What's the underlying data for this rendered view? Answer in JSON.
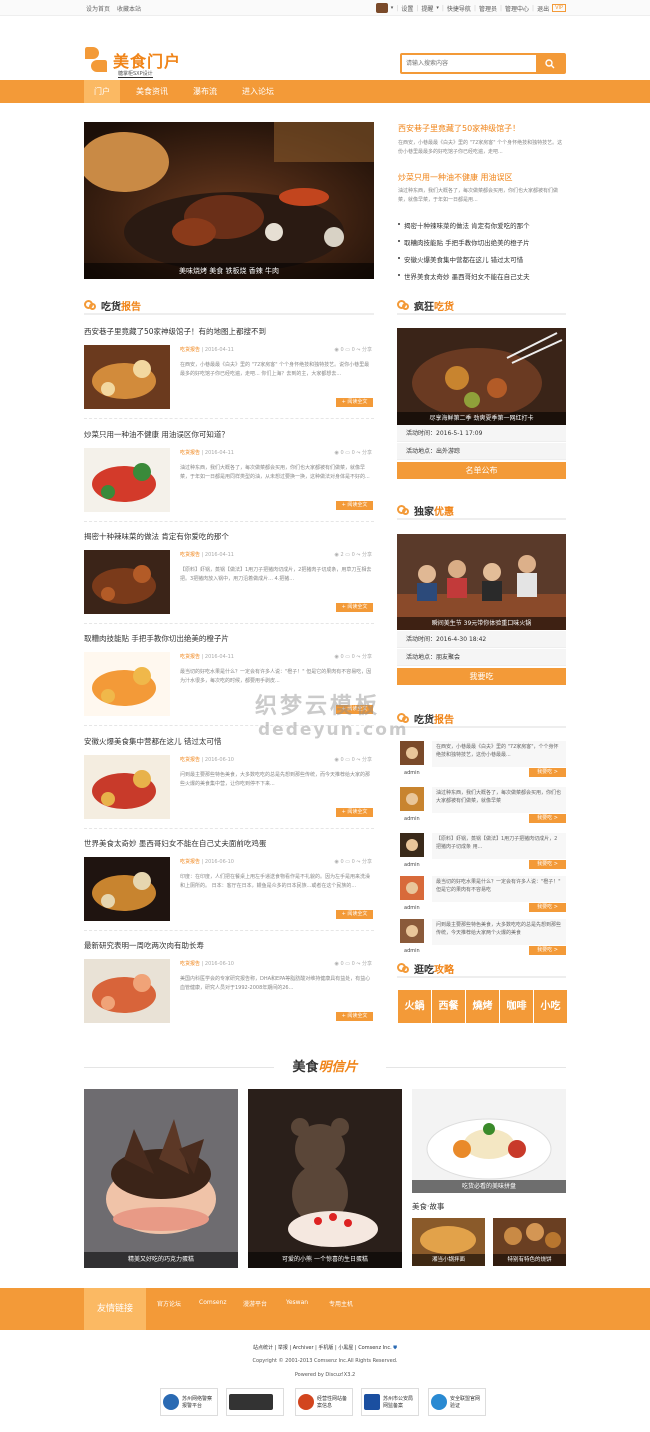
{
  "topbar": {
    "set_home": "设为首页",
    "bookmark": "收藏本站",
    "right_links": [
      "设置",
      "提醒",
      "快捷导航",
      "管理员",
      "管理中心",
      "退出"
    ],
    "vip_badge": "VIP"
  },
  "header": {
    "logo_text": "美食门户",
    "logo_sub": "糖掌柜SXP设计",
    "search_placeholder": "请输入搜索内容"
  },
  "nav": {
    "items": [
      "门户",
      "美食资讯",
      "瀑布流",
      "进入论坛"
    ],
    "active_index": 0
  },
  "hero": {
    "caption": "美味烧烤 美食 铁板烧 香辣 牛肉"
  },
  "top_news": {
    "headline1": "西安巷子里竟藏了50家神级馆子！",
    "summary1": "在西安，小巷最最《白夫》里的 \"72家房客\" 个个身怀绝技和独特技艺。这份小巷里最最多的好吃馆子你已经吃遍，走吧...",
    "headline2": "炒菜只用一种油不健康 用油误区",
    "summary2": "油过种东西，我们大概各了，每次做菜都会买用，你们也大家都被有们做菜，就像早菜，于年如一日都是用...",
    "bullets": [
      "揭密十种辣味菜的做法 肯定有你爱吃的那个",
      "取糟肉技能贴 手把手教你切出绝美的橙子片",
      "安徽火爆美食集中营都在这儿 错过太可惜",
      "世界美食太奇妙 墨西哥妇女不能在自己丈夫"
    ]
  },
  "report": {
    "title_a": "吃货",
    "title_b": "报告",
    "more_label": "+ 阅读全文",
    "articles": [
      {
        "title": "西安巷子里竟藏了50家神级馆子！有的地图上都搜不到",
        "cat": "吃货报告",
        "date": "2016-04-11",
        "views": "0",
        "comments": "0",
        "share": "分享",
        "desc": "在西安，小巷最最《白夫》里的 \"72家房客\" 个个身怀绝技和独特技艺。说你小巷里最最多的好吃馆子你已经吃遍，走吧... 你们上海？去到的主，大家都想去..."
      },
      {
        "title": "炒菜只用一种油不健康 用油误区你可知道？",
        "cat": "吃货报告",
        "date": "2016-04-11",
        "views": "0",
        "comments": "0",
        "share": "分享",
        "desc": "油过种东西，我们大概各了，每次做菜都会买用，你们也大家都被有们做菜，就像早菜，于年如一日都是用同样类型的油，从未想过要换一换，这种做法对身体是不好的..."
      },
      {
        "title": "揭密十种辣味菜的做法 肯定有你爱吃的那个",
        "cat": "吃货报告",
        "date": "2016-04-11",
        "views": "2",
        "comments": "0",
        "share": "分享",
        "desc": "【原料】虾锅，蒸锅【做法】1用刀子把猪肉切成片，2把猪肉子切成条，用草刀互相去把。3把猪肉放入锅中，用刀沿着做成片... 4.把猪..."
      },
      {
        "title": "取糟肉技能贴 手把手教你切出绝美的橙子片",
        "cat": "吃货报告",
        "date": "2016-04-11",
        "views": "0",
        "comments": "0",
        "share": "分享",
        "desc": "最当切的好吃水果是什么？一定会有许多人说：\"橙子！\" 但是它的果肉有不容易吃，因为汁水很多，每次吃的时候，都要用手剥皮..."
      },
      {
        "title": "安徽火爆美食集中营都在这儿 错过太可惜",
        "cat": "吃货报告",
        "date": "2016-06-10",
        "views": "0",
        "comments": "0",
        "share": "分享",
        "desc": "问到最主要那些特色美食，大多数吃吃的总是先想到那些传统，而今天推荐给大家的那些火爆的美食集中营，让你吃到停不下来..."
      },
      {
        "title": "世界美食太奇妙 墨西哥妇女不能在自己丈夫面前吃鸡蛋",
        "cat": "吃货报告",
        "date": "2016-06-10",
        "views": "0",
        "comments": "0",
        "share": "分享",
        "desc": "印度：在印度，人们把在餐桌上用左手递送食物看作是不礼貌的。因为左手是用来洗澡和上厕所的。 日本：客厅在日本，鳗鱼是众多的日本民族...或者在这个民族的..."
      },
      {
        "title": "最新研究表明一周吃两次肉有助长寿",
        "cat": "吃货报告",
        "date": "2016-06-10",
        "views": "0",
        "comments": "0",
        "share": "分享",
        "desc": "美国内科医学会的专家研究报告称，DHA和EPA等脂肪酸对维持健康具有益处，有益心血管健康，研究人员对于1992-2008年期间的26..."
      }
    ]
  },
  "crazy": {
    "title_a": "疯狂",
    "title_b": "吃货",
    "caption": "尽享海鲜第二季 劲爽夏季第一网红打卡",
    "rows": [
      "活动时间：2016-5-1 17:09",
      "活动地点：出外游踪"
    ],
    "button": "名单公布"
  },
  "exclusive": {
    "title_a": "独家",
    "title_b": "优惠",
    "caption": "瞬间美生节 39元带你体验重口味火锅",
    "rows": [
      "活动时间：2016-4-30 18:42",
      "活动地点：朋友聚会"
    ],
    "button": "我要吃"
  },
  "side_report": {
    "title_a": "吃货",
    "title_b": "报告",
    "go_label": "我要吃 >",
    "items": [
      {
        "name": "admin",
        "text": "在西安，小巷最最《白夫》里的 \"72家房客\"，个个身怀绝技和独特技艺，这份小巷最最..."
      },
      {
        "name": "admin",
        "text": "油过种东西，我们大概各了，每次做菜都会买用，你们也大家都被有们做菜，就像早菜"
      },
      {
        "name": "admin",
        "text": "【原料】虾锅，蒸锅【做法】1用刀子把猪肉切成片，2把猪肉子切成条 用..."
      },
      {
        "name": "admin",
        "text": "最当切的好吃水果是什么？一定会有许多人说：\"橙子！\" 但是它的果肉有不容易吃"
      },
      {
        "name": "admin",
        "text": "问到最主要那些特色美食，大多数吃吃的总是先想到那些传统，今天推荐给大家两个火爆的美食"
      }
    ]
  },
  "guide": {
    "title_a": "逛吃",
    "title_b": "攻略",
    "items": [
      "火鍋",
      "西餐",
      "燒烤",
      "咖啡",
      "小吃"
    ]
  },
  "postcard": {
    "title_a": "美食",
    "title_b": "明信片",
    "captions": [
      "精美又好吃的巧克力蛋糕",
      "可爱的小熊 一个惊喜的生日蛋糕",
      "吃货必看的美味拼盘"
    ],
    "story_title": "美食·故事",
    "story_captions": [
      "湘当小锅拌面",
      "特别有特色的烧饼"
    ]
  },
  "friends": {
    "title": "友情链接",
    "links": [
      "官方论坛",
      "Comsenz",
      "漫游平台",
      "Yeswan",
      "专用主机"
    ]
  },
  "footer": {
    "links": [
      "站点统计",
      "举报",
      "Archiver",
      "手机版",
      "小黑屋",
      "Comsenz Inc."
    ],
    "copyright": "Copyright © 2001-2013 Comsenz Inc.All Rights Reserved.",
    "powered": "Powered by Discuz!X3.2",
    "badges": [
      "苏州网络警察报警平台",
      "",
      "经营性网站备案信息",
      "苏州市公安局网监备案",
      "安全联盟官网验证"
    ]
  },
  "watermark": {
    "line1": "织梦云模板",
    "line2": "dedeyun.com"
  },
  "colors": {
    "accent": "#f39a38",
    "accent_dark": "#f08418",
    "nav_active": "#fbb963"
  }
}
